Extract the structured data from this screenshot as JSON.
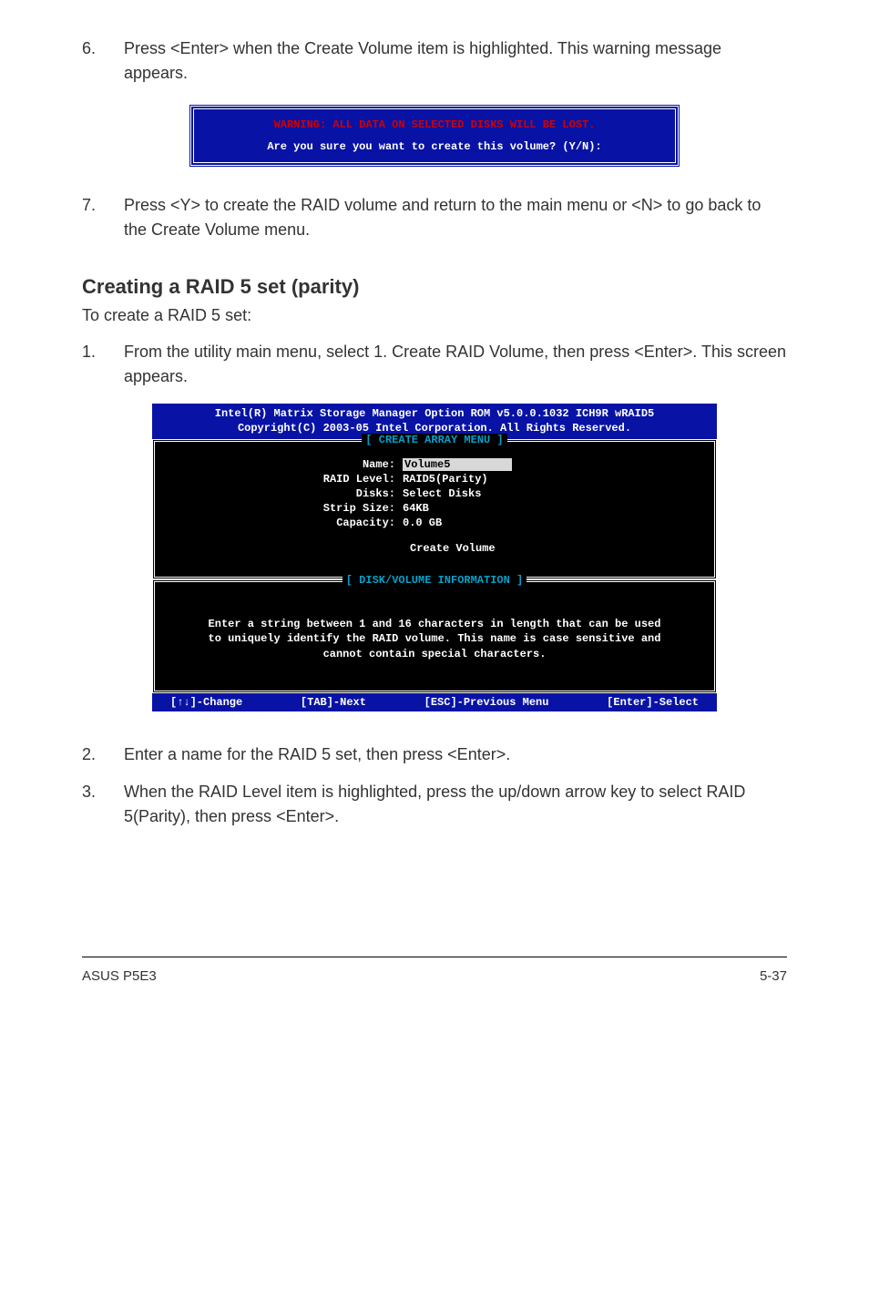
{
  "steps_top": [
    {
      "num": "6.",
      "text": "Press <Enter> when the Create Volume item is highlighted. This warning message appears."
    }
  ],
  "warn_dialog": {
    "warning_line": "WARNING: ALL DATA ON SELECTED DISKS WILL BE LOST.",
    "prompt_line": "Are you sure you want to create this volume? (Y/N):"
  },
  "steps_mid": [
    {
      "num": "7.",
      "text": "Press <Y> to create the RAID volume and return to the main menu or <N> to go back to the Create Volume menu."
    }
  ],
  "section_heading": "Creating a RAID 5 set (parity)",
  "section_intro": "To create a RAID 5 set:",
  "steps_section": [
    {
      "num": "1.",
      "text": "From the utility main menu, select 1. Create RAID Volume, then press <Enter>. This screen appears."
    }
  ],
  "bios": {
    "header_line1": "Intel(R) Matrix Storage Manager Option ROM v5.0.0.1032 ICH9R wRAID5",
    "header_line2": "Copyright(C) 2003-05 Intel Corporation. All Rights Reserved.",
    "box1_title": "[ CREATE ARRAY MENU ]",
    "fields": {
      "name_label": "Name:",
      "name_value": "Volume5",
      "raid_level_label": "RAID Level:",
      "raid_level_value": "RAID5(Parity)",
      "disks_label": "Disks:",
      "disks_value": "Select Disks",
      "strip_label": "Strip Size:",
      "strip_value": "64KB",
      "capacity_label": "Capacity:",
      "capacity_value": "0.0  GB"
    },
    "create_volume_label": "Create Volume",
    "box2_title": "[ DISK/VOLUME INFORMATION ]",
    "info_line1": "Enter a string between 1 and 16 characters in length that can be used",
    "info_line2": "to uniquely identify the RAID volume. This name is case sensitive and",
    "info_line3": "cannot contain special characters.",
    "footer": {
      "change": "[↑↓]-Change",
      "tab": "[TAB]-Next",
      "esc": "[ESC]-Previous Menu",
      "enter": "[Enter]-Select"
    }
  },
  "steps_bottom": [
    {
      "num": "2.",
      "text": "Enter a name for the RAID 5 set, then press <Enter>."
    },
    {
      "num": "3.",
      "text": "When the RAID Level item is highlighted, press the up/down arrow key to select RAID 5(Parity), then press <Enter>."
    }
  ],
  "footer": {
    "left": "ASUS P5E3",
    "right": "5-37"
  }
}
